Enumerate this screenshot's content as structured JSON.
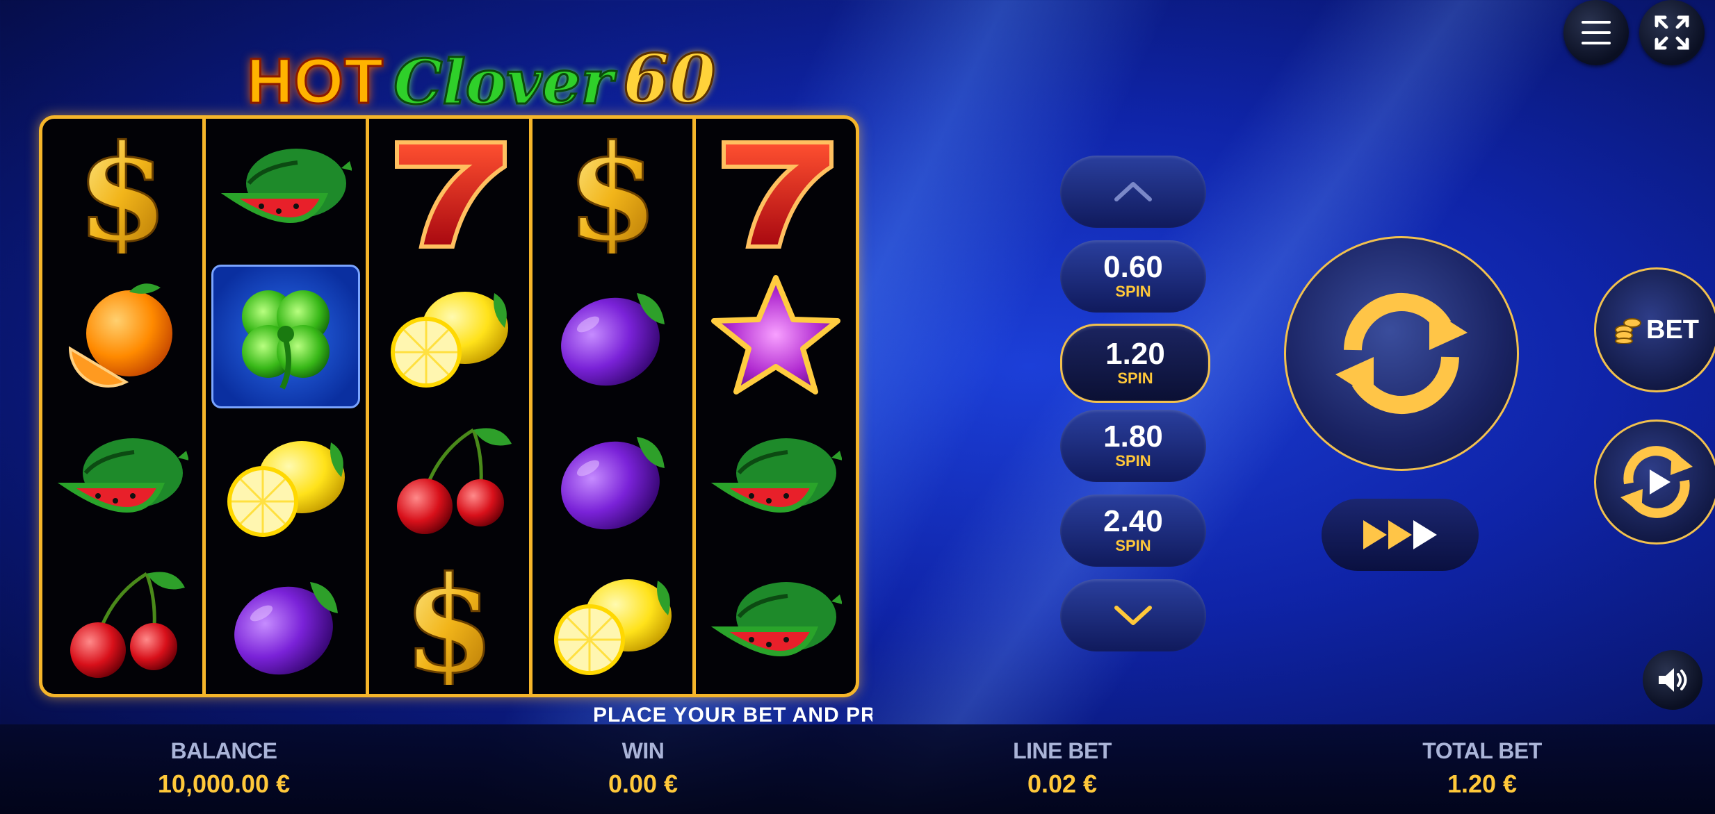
{
  "logo": {
    "word1": "HOT",
    "word2": "Clover",
    "word3": "60"
  },
  "message": "PLACE YOUR BET AND PRESS",
  "bet_options": [
    {
      "amount": "0.60",
      "label": "SPIN"
    },
    {
      "amount": "1.20",
      "label": "SPIN",
      "selected": true
    },
    {
      "amount": "1.80",
      "label": "SPIN"
    },
    {
      "amount": "2.40",
      "label": "SPIN"
    }
  ],
  "controls": {
    "bet_label": "BET"
  },
  "reels": [
    [
      "dollar",
      "orange",
      "watermelon",
      "cherry"
    ],
    [
      "watermelon",
      "clover",
      "lemon",
      "plum"
    ],
    [
      "seven",
      "lemon",
      "cherry",
      "dollar"
    ],
    [
      "dollar",
      "plum",
      "plum",
      "lemon"
    ],
    [
      "seven",
      "star",
      "watermelon",
      "watermelon"
    ]
  ],
  "footer": {
    "balance_label": "BALANCE",
    "balance_value": "10,000.00 €",
    "win_label": "WIN",
    "win_value": "0.00 €",
    "line_bet_label": "LINE BET",
    "line_bet_value": "0.02 €",
    "total_bet_label": "TOTAL BET",
    "total_bet_value": "1.20 €"
  },
  "colors": {
    "accent_gold": "#f2c14e",
    "value_gold": "#ffc83a",
    "background": "#0f24a8"
  },
  "icons": [
    "menu-icon",
    "fullscreen-icon",
    "chevron-up-icon",
    "chevron-down-icon",
    "spin-icon",
    "turbo-icon",
    "coins-icon",
    "autoplay-icon",
    "sound-icon"
  ]
}
